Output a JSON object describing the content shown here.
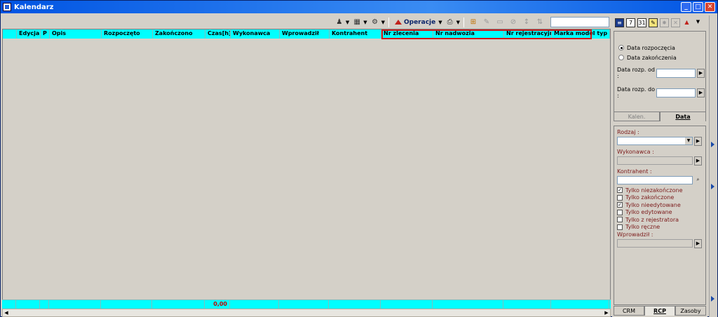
{
  "window": {
    "title": "Kalendarz"
  },
  "toolbar": {
    "operations_label": "Operacje",
    "search_value": ""
  },
  "grid": {
    "columns": [
      "",
      "Edycja",
      "P",
      "Opis",
      "Rozpoczęto",
      "Zakończono",
      "Czas[h]",
      "Wykonawca",
      "Wprowadził",
      "Kontrahent",
      "Nr zlecenia",
      "Nr nadwozia",
      "Nr rejestracyjny",
      "Marka model typ"
    ],
    "footer_total": "0,00"
  },
  "right_panel": {
    "date_mode": {
      "option_start": "Data rozpoczęcia",
      "option_end": "Data zakończenia",
      "selected": "Data rozpoczęcia"
    },
    "date_from_label": "Data rozp. od :",
    "date_to_label": "Data rozp. do :",
    "date_from_value": "",
    "date_to_value": "",
    "tabs_top": [
      "Kalen.",
      "Data"
    ],
    "active_tab_top": "Data",
    "filters": {
      "rodzaj_label": "Rodzaj :",
      "wykonawca_label": "Wykonawca :",
      "kontrahent_label": "Kontrahent :",
      "wprowadzil_label": "Wprowadził :",
      "checkboxes": [
        {
          "label": "Tylko niezakończone",
          "checked": true
        },
        {
          "label": "Tylko zakończone",
          "checked": false
        },
        {
          "label": "Tylko nieedytowane",
          "checked": true
        },
        {
          "label": "Tylko edytowane",
          "checked": false
        },
        {
          "label": "Tylko z rejestratora",
          "checked": false
        },
        {
          "label": "Tylko ręczne",
          "checked": false
        }
      ]
    },
    "tabs_bottom": [
      "CRM",
      "RCP",
      "Zasoby"
    ],
    "active_tab_bottom": "RCP"
  },
  "colors": {
    "grid_header": "#00ffff",
    "highlight_box": "#d01818",
    "title_bar": "#0054e3"
  }
}
